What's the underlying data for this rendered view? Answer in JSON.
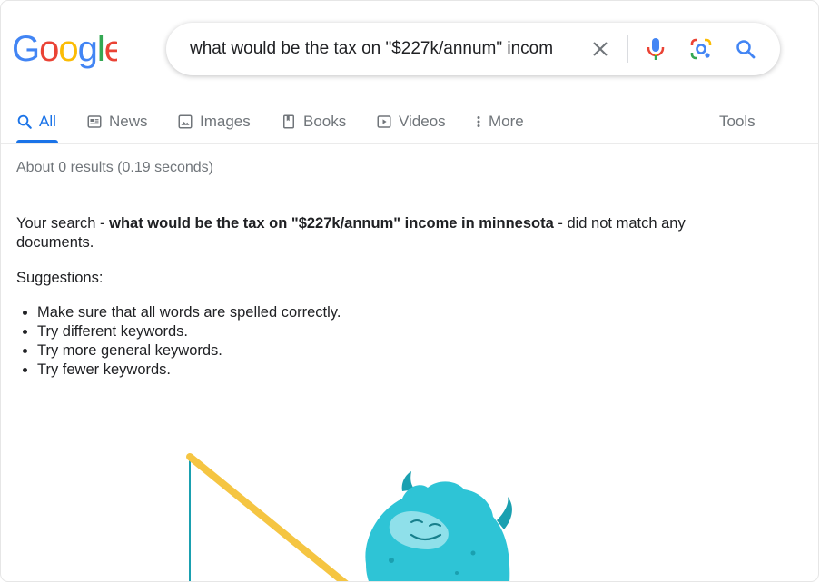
{
  "logo": {
    "text": "Google"
  },
  "search": {
    "query": "what would be the tax on \"$227k/annum\" incom"
  },
  "tabs": [
    {
      "label": "All",
      "icon": "search-icon",
      "active": true
    },
    {
      "label": "News",
      "icon": "news-icon"
    },
    {
      "label": "Images",
      "icon": "image-icon"
    },
    {
      "label": "Books",
      "icon": "book-icon"
    },
    {
      "label": "Videos",
      "icon": "video-icon"
    },
    {
      "label": "More",
      "icon": "more-vert-icon"
    }
  ],
  "tools_label": "Tools",
  "stats": "About 0 results (0.19 seconds)",
  "no_match": {
    "prefix": "Your search - ",
    "query": "what would be the tax on \"$227k/annum\" income in minnesota",
    "suffix": " - did not match any documents."
  },
  "suggestions": {
    "heading": "Suggestions:",
    "items": [
      "Make sure that all words are spelled correctly.",
      "Try different keywords.",
      "Try more general keywords.",
      "Try fewer keywords."
    ]
  },
  "colors": {
    "blue": "#4285F4",
    "red": "#EA4335",
    "yellow": "#FBBC05",
    "green": "#34A853",
    "active_tab": "#1a73e8",
    "muted": "#70757a",
    "monster": "#2ec4d6",
    "rod": "#f5c542"
  }
}
